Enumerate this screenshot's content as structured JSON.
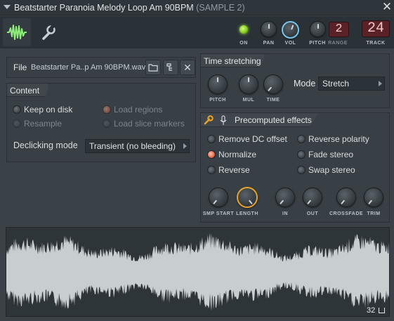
{
  "window": {
    "title": "Beatstarter Paranoia Melody Loop Am 90BPM",
    "sample_tag": "(SAMPLE 2)",
    "close_glyph": "✕"
  },
  "toolbar": {
    "knobs": {
      "on_label": "ON",
      "pan_label": "PAN",
      "vol_label": "VOL",
      "pitch_label": "PITCH",
      "range_label": "RANGE",
      "track_label": "TRACK"
    },
    "range_value": "2",
    "track_value": "24",
    "accent_color": "#7ac4ea"
  },
  "file": {
    "label": "File",
    "value": "Beatstarter Pa..p Am 90BPM.wav",
    "icons": [
      "folder-icon",
      "edit-tree-icon",
      "close-icon"
    ],
    "clear_glyph": "✕"
  },
  "content": {
    "title": "Content",
    "keep_on_disk": "Keep on disk",
    "resample": "Resample",
    "load_regions": "Load regions",
    "load_slice_markers": "Load slice markers",
    "declicking_label": "Declicking mode",
    "declicking_value": "Transient (no bleeding)"
  },
  "time_stretching": {
    "title": "Time stretching",
    "pitch_label": "PITCH",
    "mul_label": "MUL",
    "time_label": "TIME",
    "mode_label": "Mode",
    "mode_value": "Stretch"
  },
  "precomputed": {
    "title": "Precomputed effects",
    "remove_dc_offset": "Remove DC offset",
    "normalize": "Normalize",
    "reverse": "Reverse",
    "reverse_polarity": "Reverse polarity",
    "fade_stereo": "Fade stereo",
    "swap_stereo": "Swap stereo",
    "knobs": {
      "smp_start": "SMP START",
      "length": "LENGTH",
      "in": "IN",
      "out": "OUT",
      "crossfade": "CROSSFADE",
      "trim": "TRIM"
    },
    "highlight_color": "#e8a32c",
    "radio_on_color": "#e36a4a"
  },
  "waveform": {
    "zoom_value": "32",
    "wave_color": "#c8cdd0"
  }
}
